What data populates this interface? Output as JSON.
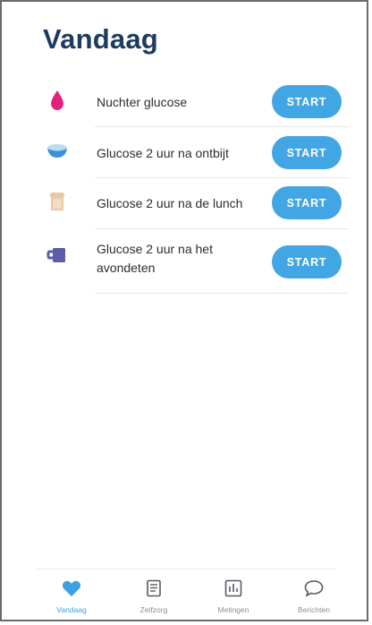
{
  "page": {
    "title": "Vandaag"
  },
  "colors": {
    "accent": "#43a6e4",
    "title": "#1d3a5f",
    "drop": "#e2217e",
    "bowl": "#3c8fd8",
    "bread": "#e8c8a6",
    "mug": "#5b5ea6"
  },
  "tasks": [
    {
      "label": "Nuchter glucose",
      "icon": "drop-icon",
      "button": "START"
    },
    {
      "label": "Glucose 2 uur na ontbijt",
      "icon": "bowl-icon",
      "button": "START"
    },
    {
      "label": "Glucose 2 uur na de lunch",
      "icon": "bread-icon",
      "button": "START"
    },
    {
      "label": "Glucose 2 uur na het avondeten",
      "icon": "mug-icon",
      "button": "START"
    }
  ],
  "tabbar": [
    {
      "label": "Vandaag",
      "icon": "heart-icon",
      "active": true
    },
    {
      "label": "Zelfzorg",
      "icon": "document-icon",
      "active": false
    },
    {
      "label": "Metingen",
      "icon": "chart-icon",
      "active": false
    },
    {
      "label": "Berichten",
      "icon": "chat-bubble-icon",
      "active": false
    }
  ]
}
